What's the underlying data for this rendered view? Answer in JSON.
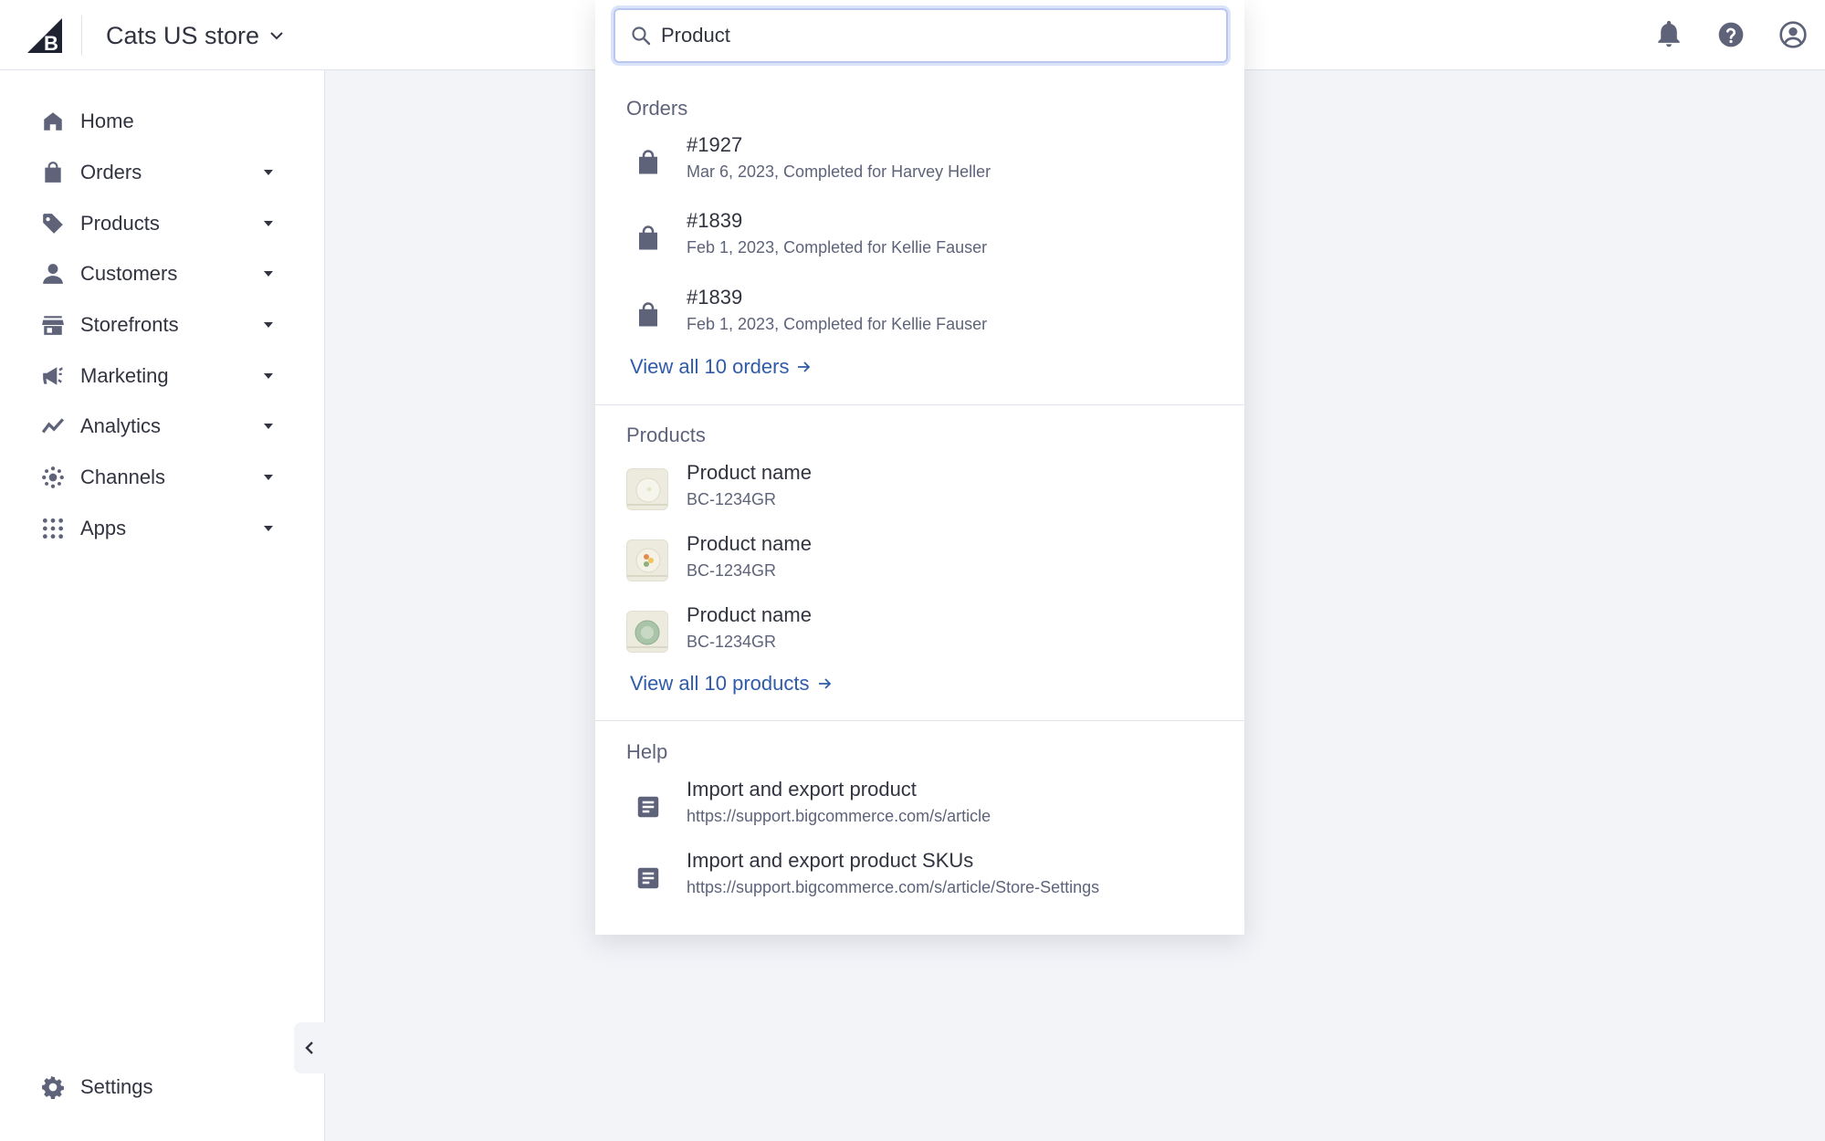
{
  "header": {
    "store_name": "Cats US store"
  },
  "search": {
    "value": "Product",
    "placeholder": ""
  },
  "sidebar": {
    "items": [
      {
        "label": "Home",
        "icon": "home-icon",
        "expandable": false
      },
      {
        "label": "Orders",
        "icon": "shopping-bag-icon",
        "expandable": true
      },
      {
        "label": "Products",
        "icon": "tag-icon",
        "expandable": true
      },
      {
        "label": "Customers",
        "icon": "person-icon",
        "expandable": true
      },
      {
        "label": "Storefronts",
        "icon": "storefront-icon",
        "expandable": true
      },
      {
        "label": "Marketing",
        "icon": "megaphone-icon",
        "expandable": true
      },
      {
        "label": "Analytics",
        "icon": "trending-line-icon",
        "expandable": true
      },
      {
        "label": "Channels",
        "icon": "channels-hub-icon",
        "expandable": true
      },
      {
        "label": "Apps",
        "icon": "apps-grid-icon",
        "expandable": true
      }
    ],
    "settings_label": "Settings"
  },
  "results": {
    "orders": {
      "title": "Orders",
      "items": [
        {
          "title": "#1927",
          "subtitle": "Mar 6, 2023, Completed for Harvey Heller"
        },
        {
          "title": "#1839",
          "subtitle": "Feb 1, 2023, Completed for Kellie Fauser"
        },
        {
          "title": "#1839",
          "subtitle": "Feb 1, 2023, Completed for Kellie Fauser"
        }
      ],
      "view_all": "View all 10 orders"
    },
    "products": {
      "title": "Products",
      "items": [
        {
          "title": "Product name",
          "subtitle": "BC-1234GR"
        },
        {
          "title": "Product name",
          "subtitle": "BC-1234GR"
        },
        {
          "title": "Product name",
          "subtitle": "BC-1234GR"
        }
      ],
      "view_all": "View all 10 products"
    },
    "help": {
      "title": "Help",
      "items": [
        {
          "title": "Import and export product",
          "subtitle": "https://support.bigcommerce.com/s/article"
        },
        {
          "title": "Import and export product SKUs",
          "subtitle": "https://support.bigcommerce.com/s/article/Store-Settings"
        }
      ]
    }
  },
  "colors": {
    "link": "#2f5ba8",
    "icon": "#5e637a",
    "text": "#313440",
    "background": "#f3f4f8"
  }
}
